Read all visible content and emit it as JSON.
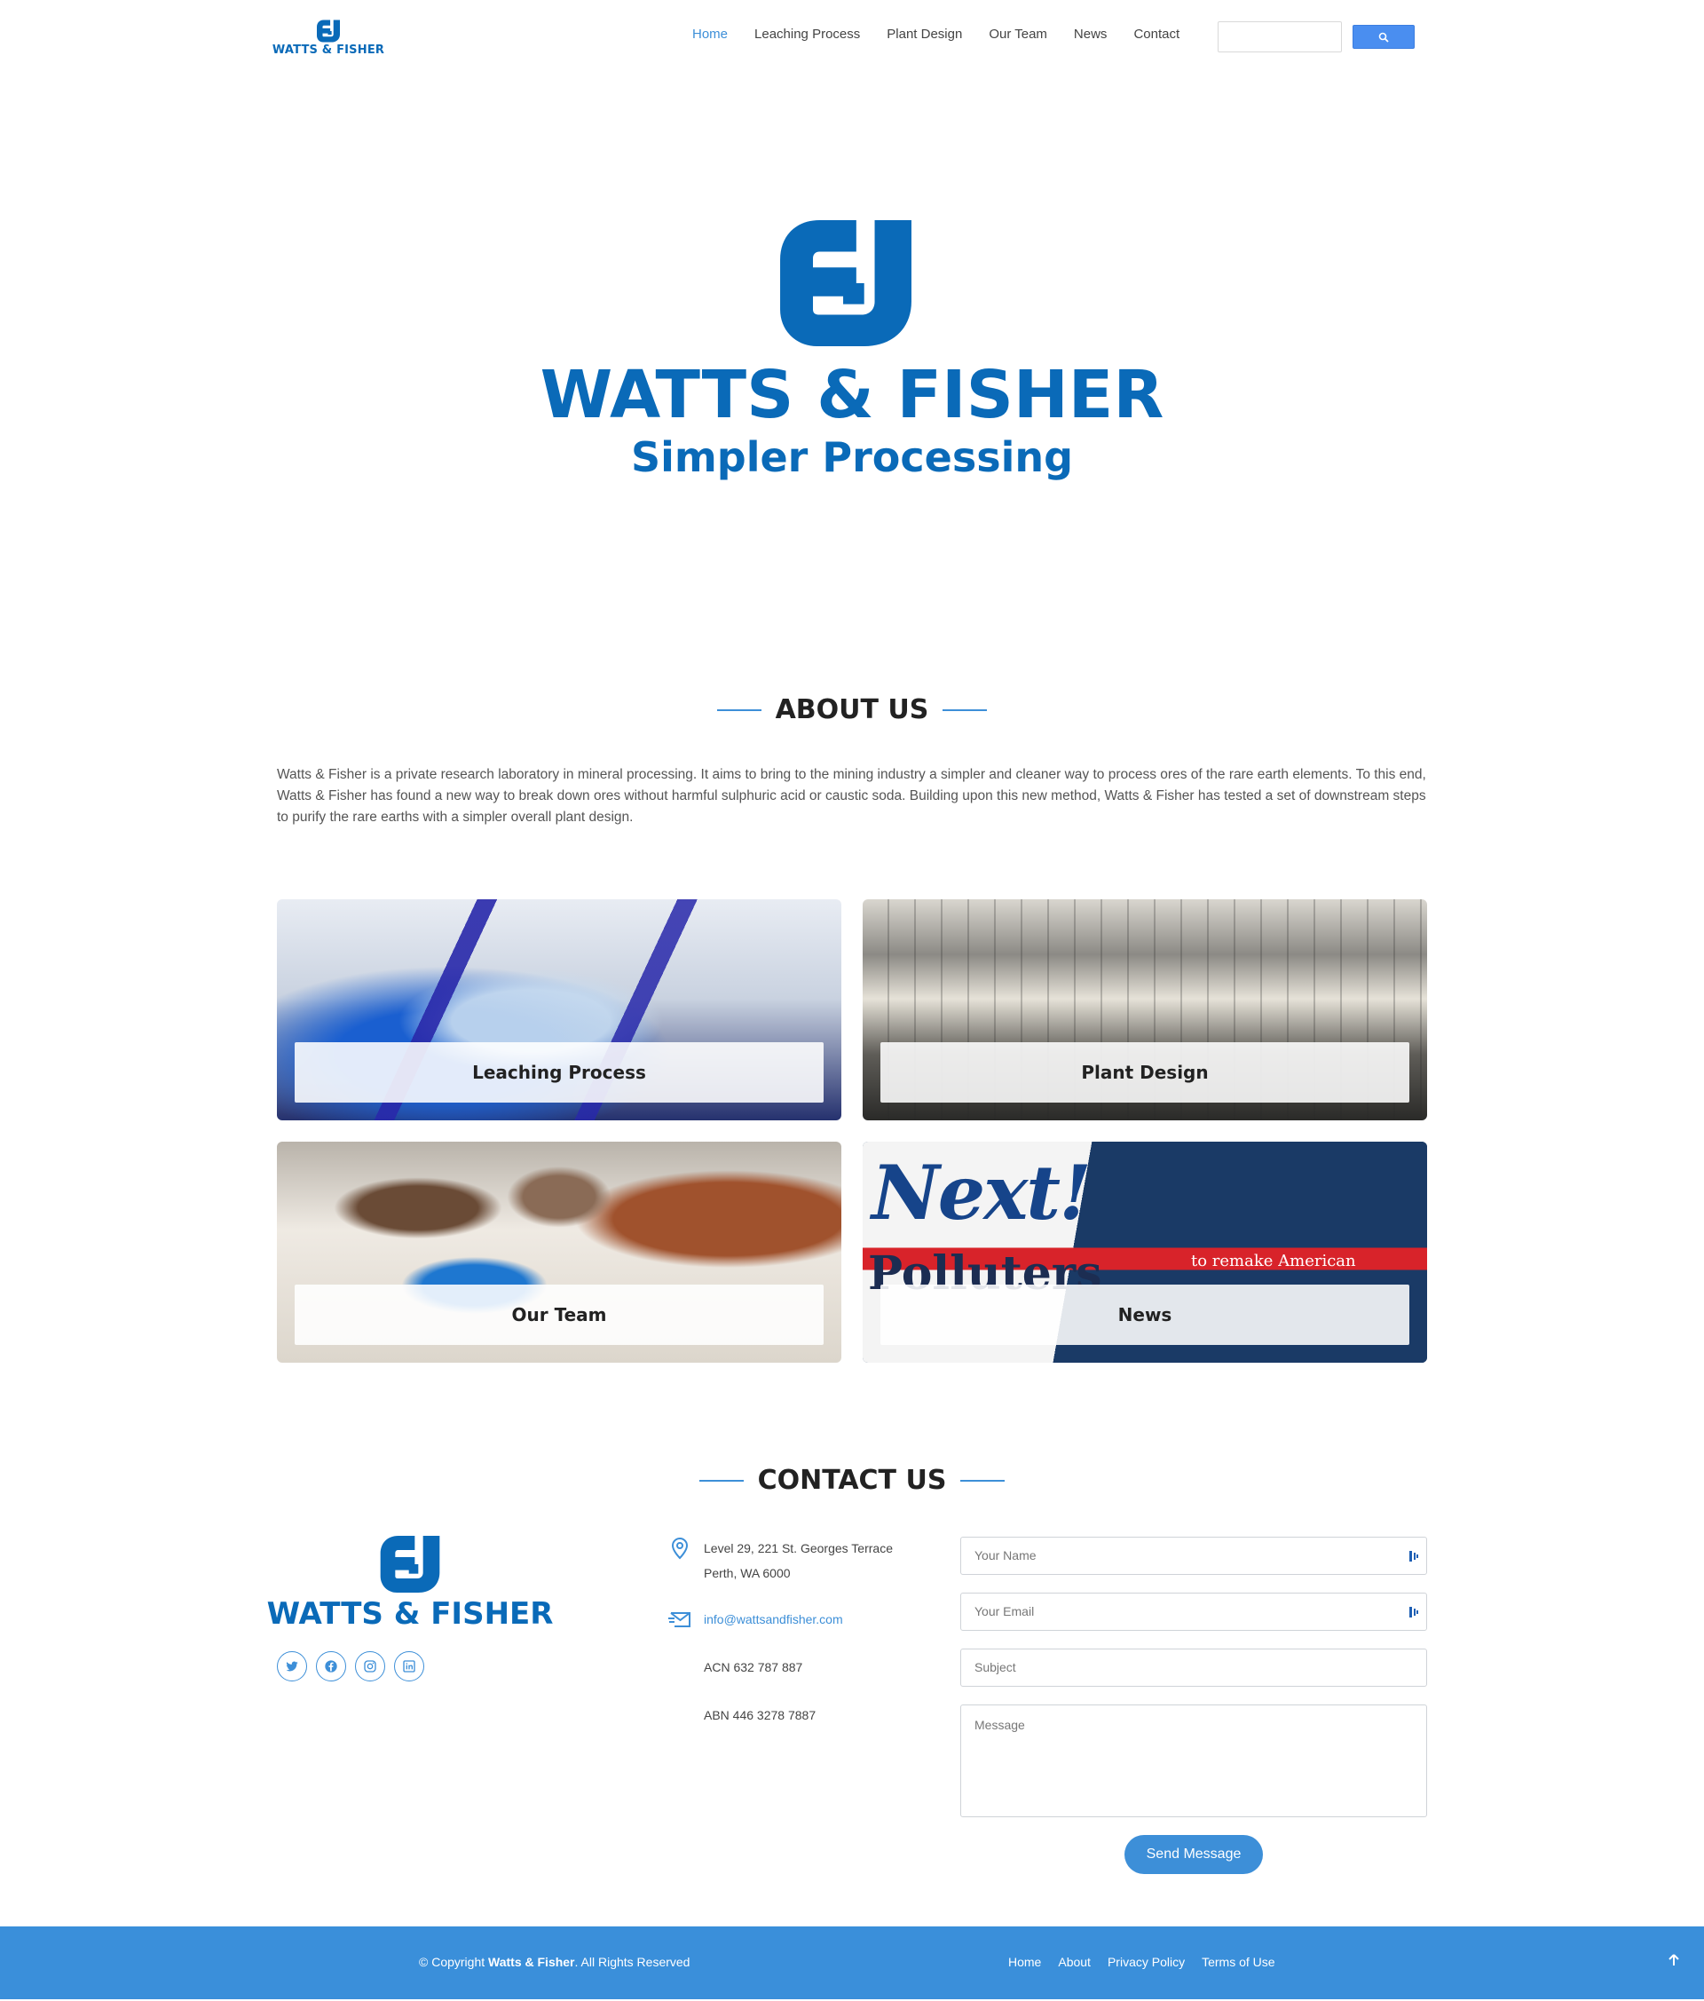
{
  "header": {
    "logo_text": "WATTS & FISHER",
    "nav": [
      "Home",
      "Leaching Process",
      "Plant Design",
      "Our Team",
      "News",
      "Contact"
    ],
    "active_nav": "Home",
    "search": {
      "placeholder": "",
      "button_icon": "search-icon"
    }
  },
  "hero": {
    "title": "WATTS & FISHER",
    "subtitle": "Simpler Processing"
  },
  "about": {
    "title": "ABOUT US",
    "text": "Watts & Fisher is a private research laboratory in mineral processing. It aims to bring to the mining industry a simpler and cleaner way to process ores of the rare earth elements. To this end, Watts & Fisher has found a new way to break down ores without harmful sulphuric acid or caustic soda. Building upon this new method, Watts & Fisher has tested a set of downstream steps to purify the rare earths with a simpler overall plant design."
  },
  "cards": [
    {
      "label": "Leaching Process"
    },
    {
      "label": "Plant Design"
    },
    {
      "label": "Our Team"
    },
    {
      "label": "News"
    }
  ],
  "news_card_image_text": {
    "big": "Next!",
    "polluters": "Polluters",
    "strip": "to remake American"
  },
  "contact": {
    "title": "CONTACT US",
    "logo_text": "WATTS & FISHER",
    "socials": [
      "twitter-icon",
      "facebook-icon",
      "instagram-icon",
      "linkedin-icon"
    ],
    "address_line1": "Level 29, 221 St. Georges Terrace",
    "address_line2": "Perth, WA 6000",
    "email": "info@wattsandfisher.com",
    "acn": "ACN 632 787 887",
    "abn": "ABN 446 3278 7887",
    "form": {
      "name_placeholder": "Your Name",
      "email_placeholder": "Your Email",
      "subject_placeholder": "Subject",
      "message_placeholder": "Message",
      "submit": "Send Message"
    }
  },
  "footer": {
    "copyright_prefix": "© Copyright ",
    "copyright_brand": "Watts & Fisher",
    "copyright_suffix": ". All Rights Reserved",
    "links": [
      "Home",
      "About",
      "Privacy Policy",
      "Terms of Use"
    ]
  },
  "colors": {
    "brand": "#0a6ab8",
    "accent": "#3d8fd8",
    "footer": "#3a8fda"
  }
}
